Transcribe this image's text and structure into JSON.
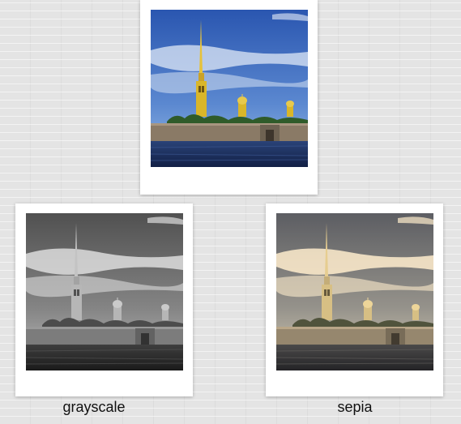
{
  "photos": [
    {
      "id": "original",
      "filter": "none"
    },
    {
      "id": "grayscale",
      "filter": "grayscale"
    },
    {
      "id": "sepia",
      "filter": "sepia"
    }
  ],
  "labels": {
    "grayscale": "grayscale",
    "sepia": "sepia"
  },
  "colors": {
    "sky_top": "#2f5db5",
    "sky_bottom": "#7aa7e0",
    "spire_gold": "#e6c23a",
    "tower_yellow": "#d9b62a",
    "wall": "#8a7a66",
    "water": "#1f3466"
  }
}
